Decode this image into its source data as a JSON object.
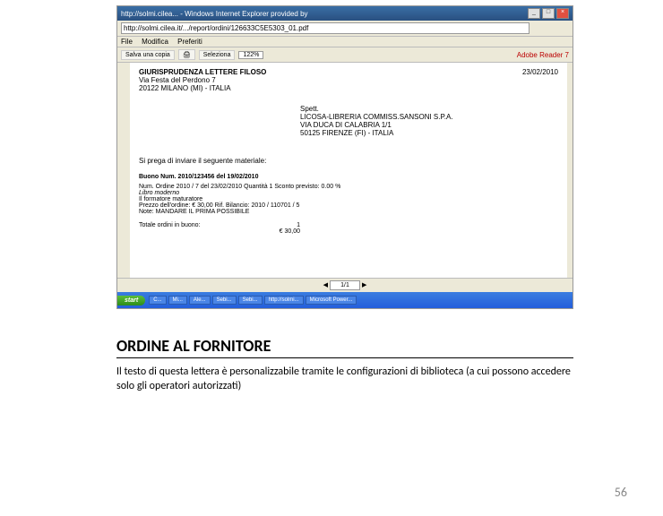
{
  "window": {
    "title": "http://solmi.cilea... - Windows Internet Explorer provided by",
    "min": "_",
    "max": "□",
    "close": "×"
  },
  "address": {
    "url": "http://solmi.cilea.it/.../report/ordini/126633C5E5303_01.pdf"
  },
  "menu": {
    "file": "File",
    "modifica": "Modifica",
    "preferiti": "Preferiti"
  },
  "toolbar": {
    "save": "Salva una copia",
    "print": "🖨",
    "seleziona": "Seleziona",
    "zoom": "122%",
    "adobe": "Adobe Reader 7"
  },
  "doc": {
    "sender_line1": "GIURISPRUDENZA LETTERE FILOSO",
    "sender_line2": "Via Festa del Perdono 7",
    "sender_line3": "20122 MILANO (MI) - ITALIA",
    "date": "23/02/2010",
    "rec_line0": "Spett.",
    "rec_line1": "LICOSA-LIBRERIA COMMISS.SANSONI S.P.A.",
    "rec_line2": "VIA DUCA DI CALABRIA 1/1",
    "rec_line3": "50125 FIRENZE (FI) - ITALIA",
    "body": "Si prega di inviare il seguente materiale:",
    "buono": "Buono Num. 2010/123456  del 19/02/2010",
    "ord_line1": "Num. Ordine 2010 / 7   del 23/02/2010   Quantità 1   Sconto previsto: 0.00 %",
    "ord_line2": "Libro moderno",
    "ord_line3": "Il formatore maturatore",
    "ord_line4": "Prezzo dell'ordine: € 30,00    Rif. Bilancio: 2010 / 110701 / 5",
    "ord_line5": "Note: MANDARE IL PRIMA POSSIBILE",
    "tot_label": "Totale ordini in buono:",
    "tot_qty": "1",
    "tot_price": "€ 30,00"
  },
  "pdfnav": {
    "page": "1/1",
    "prev": "◀",
    "next": "▶"
  },
  "taskbar": {
    "start": "start",
    "items": [
      "C...",
      "Mi...",
      "Ale...",
      "Sebi...",
      "Sebi...",
      "http://solmi...",
      "Microsoft Power..."
    ]
  },
  "slide": {
    "title": "ORDINE AL FORNITORE",
    "body": "Il testo di questa lettera è personalizzabile tramite le configurazioni di biblioteca (a cui possono accedere solo gli operatori autorizzati)",
    "page": "56"
  }
}
